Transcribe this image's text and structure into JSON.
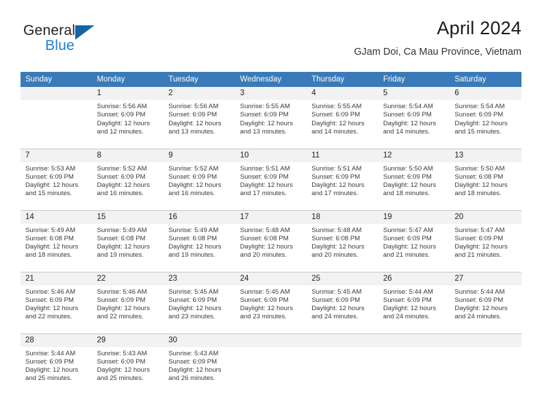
{
  "brand": {
    "word_one": "General",
    "word_two": "Blue",
    "triangle_icon": "triangle-logo-icon"
  },
  "header": {
    "title": "April 2024",
    "subtitle": "GJam Doi, Ca Mau Province, Vietnam"
  },
  "colors": {
    "header_blue": "#3a7ab8",
    "brand_blue": "#1b7fd4",
    "triangle_blue": "#1265a8",
    "daynum_bg": "#f2f2f2",
    "separator": "#c8c8c8"
  },
  "calendar": {
    "weekdays": [
      "Sunday",
      "Monday",
      "Tuesday",
      "Wednesday",
      "Thursday",
      "Friday",
      "Saturday"
    ],
    "weeks": [
      [
        {
          "day": "",
          "info": ""
        },
        {
          "day": "1",
          "info": "Sunrise: 5:56 AM\nSunset: 6:09 PM\nDaylight: 12 hours\nand 12 minutes."
        },
        {
          "day": "2",
          "info": "Sunrise: 5:56 AM\nSunset: 6:09 PM\nDaylight: 12 hours\nand 13 minutes."
        },
        {
          "day": "3",
          "info": "Sunrise: 5:55 AM\nSunset: 6:09 PM\nDaylight: 12 hours\nand 13 minutes."
        },
        {
          "day": "4",
          "info": "Sunrise: 5:55 AM\nSunset: 6:09 PM\nDaylight: 12 hours\nand 14 minutes."
        },
        {
          "day": "5",
          "info": "Sunrise: 5:54 AM\nSunset: 6:09 PM\nDaylight: 12 hours\nand 14 minutes."
        },
        {
          "day": "6",
          "info": "Sunrise: 5:54 AM\nSunset: 6:09 PM\nDaylight: 12 hours\nand 15 minutes."
        }
      ],
      [
        {
          "day": "7",
          "info": "Sunrise: 5:53 AM\nSunset: 6:09 PM\nDaylight: 12 hours\nand 15 minutes."
        },
        {
          "day": "8",
          "info": "Sunrise: 5:52 AM\nSunset: 6:09 PM\nDaylight: 12 hours\nand 16 minutes."
        },
        {
          "day": "9",
          "info": "Sunrise: 5:52 AM\nSunset: 6:09 PM\nDaylight: 12 hours\nand 16 minutes."
        },
        {
          "day": "10",
          "info": "Sunrise: 5:51 AM\nSunset: 6:09 PM\nDaylight: 12 hours\nand 17 minutes."
        },
        {
          "day": "11",
          "info": "Sunrise: 5:51 AM\nSunset: 6:09 PM\nDaylight: 12 hours\nand 17 minutes."
        },
        {
          "day": "12",
          "info": "Sunrise: 5:50 AM\nSunset: 6:09 PM\nDaylight: 12 hours\nand 18 minutes."
        },
        {
          "day": "13",
          "info": "Sunrise: 5:50 AM\nSunset: 6:08 PM\nDaylight: 12 hours\nand 18 minutes."
        }
      ],
      [
        {
          "day": "14",
          "info": "Sunrise: 5:49 AM\nSunset: 6:08 PM\nDaylight: 12 hours\nand 18 minutes."
        },
        {
          "day": "15",
          "info": "Sunrise: 5:49 AM\nSunset: 6:08 PM\nDaylight: 12 hours\nand 19 minutes."
        },
        {
          "day": "16",
          "info": "Sunrise: 5:49 AM\nSunset: 6:08 PM\nDaylight: 12 hours\nand 19 minutes."
        },
        {
          "day": "17",
          "info": "Sunrise: 5:48 AM\nSunset: 6:08 PM\nDaylight: 12 hours\nand 20 minutes."
        },
        {
          "day": "18",
          "info": "Sunrise: 5:48 AM\nSunset: 6:08 PM\nDaylight: 12 hours\nand 20 minutes."
        },
        {
          "day": "19",
          "info": "Sunrise: 5:47 AM\nSunset: 6:09 PM\nDaylight: 12 hours\nand 21 minutes."
        },
        {
          "day": "20",
          "info": "Sunrise: 5:47 AM\nSunset: 6:09 PM\nDaylight: 12 hours\nand 21 minutes."
        }
      ],
      [
        {
          "day": "21",
          "info": "Sunrise: 5:46 AM\nSunset: 6:09 PM\nDaylight: 12 hours\nand 22 minutes."
        },
        {
          "day": "22",
          "info": "Sunrise: 5:46 AM\nSunset: 6:09 PM\nDaylight: 12 hours\nand 22 minutes."
        },
        {
          "day": "23",
          "info": "Sunrise: 5:45 AM\nSunset: 6:09 PM\nDaylight: 12 hours\nand 23 minutes."
        },
        {
          "day": "24",
          "info": "Sunrise: 5:45 AM\nSunset: 6:09 PM\nDaylight: 12 hours\nand 23 minutes."
        },
        {
          "day": "25",
          "info": "Sunrise: 5:45 AM\nSunset: 6:09 PM\nDaylight: 12 hours\nand 24 minutes."
        },
        {
          "day": "26",
          "info": "Sunrise: 5:44 AM\nSunset: 6:09 PM\nDaylight: 12 hours\nand 24 minutes."
        },
        {
          "day": "27",
          "info": "Sunrise: 5:44 AM\nSunset: 6:09 PM\nDaylight: 12 hours\nand 24 minutes."
        }
      ],
      [
        {
          "day": "28",
          "info": "Sunrise: 5:44 AM\nSunset: 6:09 PM\nDaylight: 12 hours\nand 25 minutes."
        },
        {
          "day": "29",
          "info": "Sunrise: 5:43 AM\nSunset: 6:09 PM\nDaylight: 12 hours\nand 25 minutes."
        },
        {
          "day": "30",
          "info": "Sunrise: 5:43 AM\nSunset: 6:09 PM\nDaylight: 12 hours\nand 26 minutes."
        },
        {
          "day": "",
          "info": ""
        },
        {
          "day": "",
          "info": ""
        },
        {
          "day": "",
          "info": ""
        },
        {
          "day": "",
          "info": ""
        }
      ]
    ]
  }
}
